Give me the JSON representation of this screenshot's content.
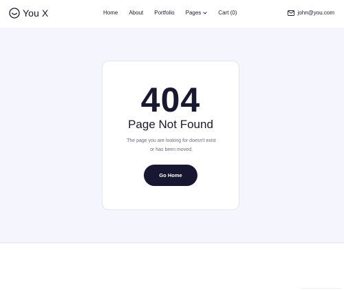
{
  "header": {
    "brand": "You X",
    "nav": [
      {
        "label": "Home"
      },
      {
        "label": "About"
      },
      {
        "label": "Portfolio"
      },
      {
        "label": "Pages"
      },
      {
        "label": "Cart (0)"
      }
    ],
    "email": "john@you.com"
  },
  "error": {
    "code": "404",
    "title": "Page Not Found",
    "message_line1": "The page you are looking for doesn't exist",
    "message_line2": "or has been moved.",
    "button_label": "Go Home"
  },
  "colors": {
    "accent": "#171731",
    "hero_background": "#f5f6fd",
    "text_muted": "#6a6c80"
  },
  "icons": {
    "logo": "smile-circle-icon",
    "pages_dropdown": "chevron-down-icon",
    "email": "mail-icon"
  }
}
